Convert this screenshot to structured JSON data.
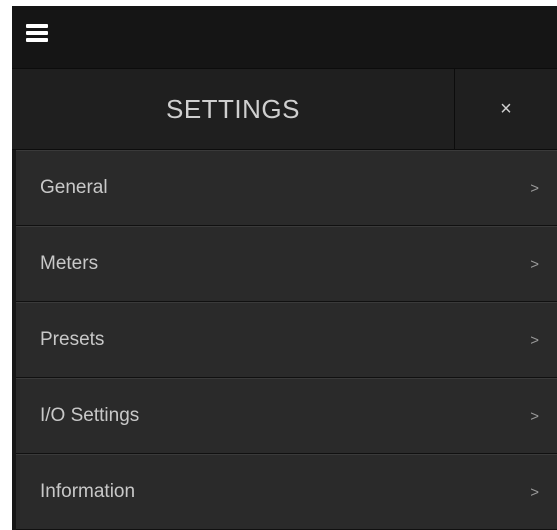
{
  "topbar": {
    "menu_icon": "hamburger-icon"
  },
  "header": {
    "title": "SETTINGS",
    "close_label": "×"
  },
  "menu": {
    "items": [
      {
        "label": "General",
        "chevron": ">"
      },
      {
        "label": "Meters",
        "chevron": ">"
      },
      {
        "label": "Presets",
        "chevron": ">"
      },
      {
        "label": "I/O Settings",
        "chevron": ">"
      },
      {
        "label": "Information",
        "chevron": ">"
      }
    ]
  },
  "colors": {
    "background": "#161616",
    "header_bg": "#1f1f1f",
    "item_bg": "#2a2a2a",
    "text": "#c8c8c8"
  }
}
